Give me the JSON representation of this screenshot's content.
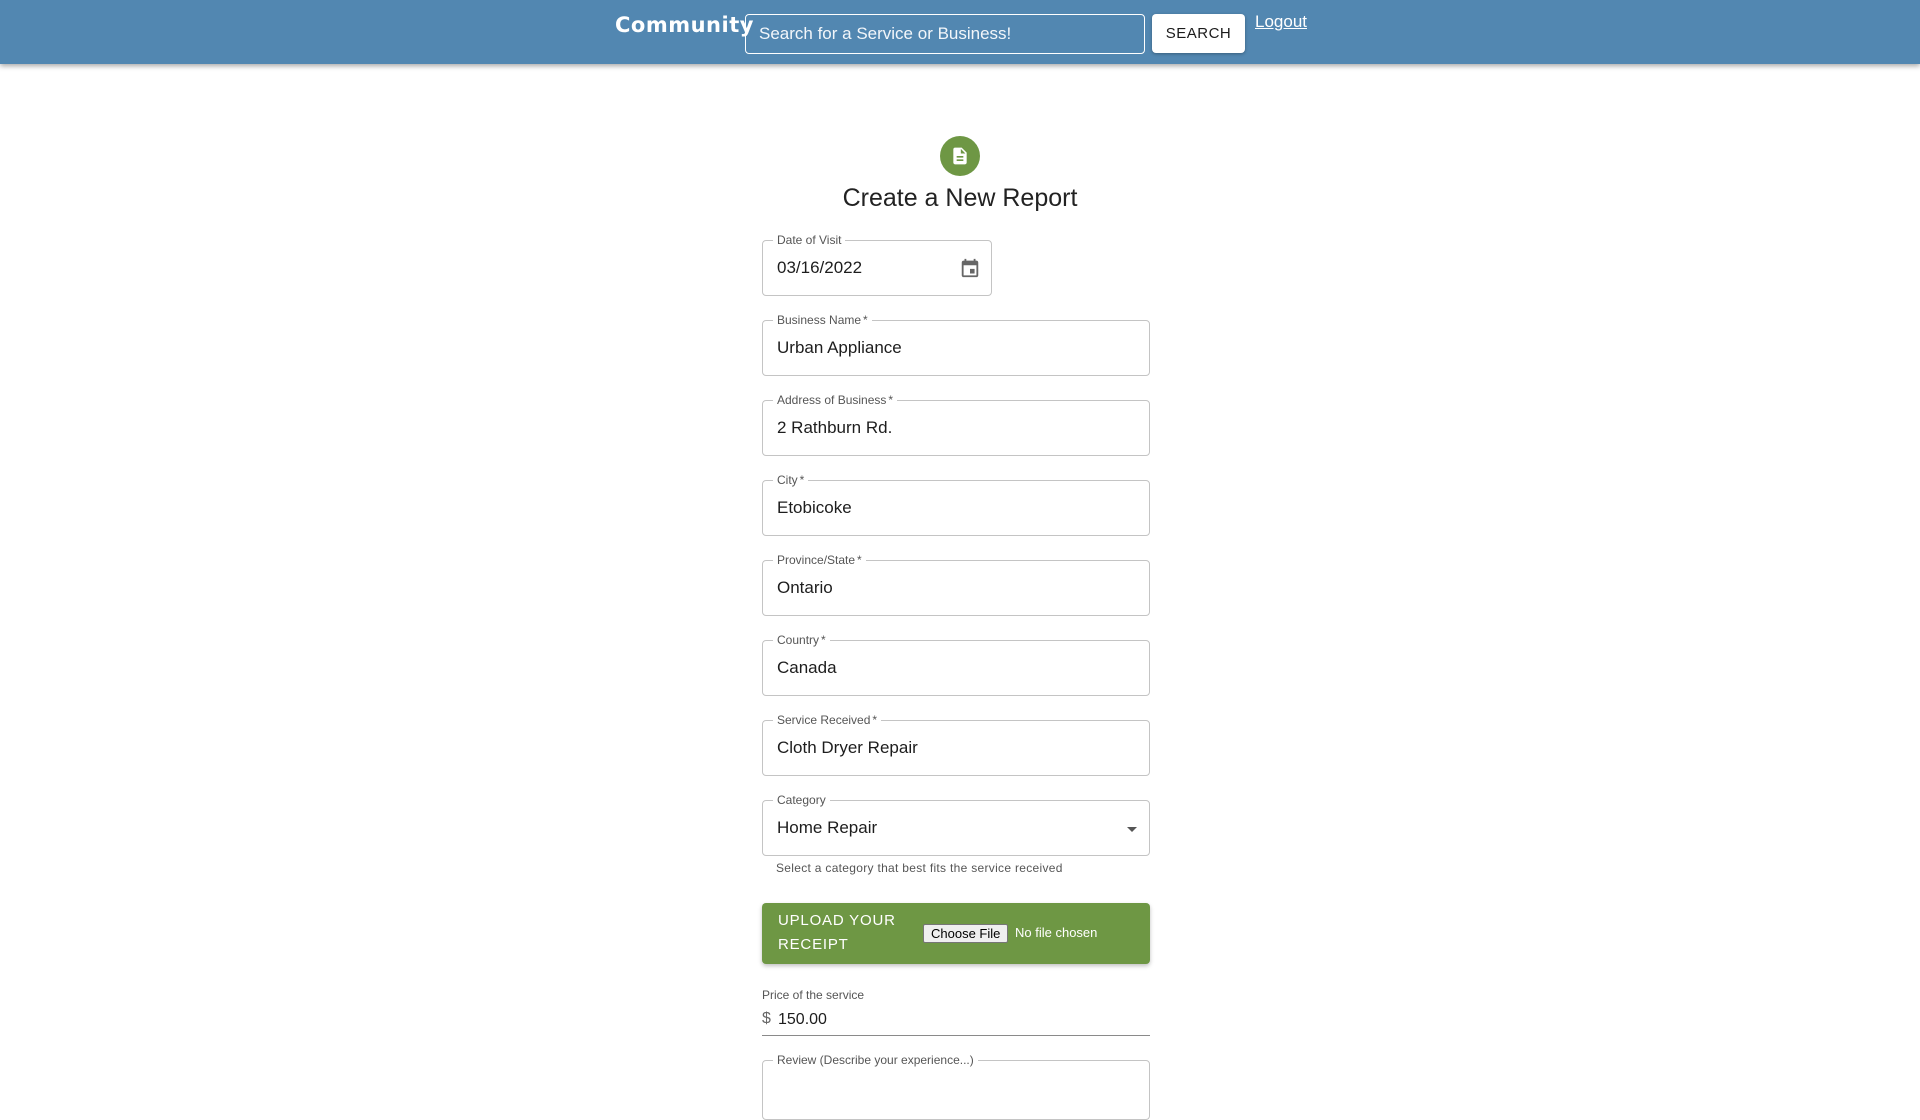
{
  "header": {
    "brand": "Community",
    "search_placeholder": "Search for a Service or Business!",
    "search_button": "SEARCH",
    "logout": "Logout",
    "bar_color": "#5287b1"
  },
  "form": {
    "title": "Create a New Report",
    "icon": "description-icon",
    "accent_color": "#6e9744",
    "fields": {
      "date": {
        "label": "Date of Visit",
        "value": "03/16/2022",
        "icon": "calendar-icon"
      },
      "business_name": {
        "label": "Business Name",
        "required_mark": "*",
        "value": "Urban Appliance"
      },
      "address": {
        "label": "Address of Business",
        "required_mark": "*",
        "value": "2 Rathburn Rd."
      },
      "city": {
        "label": "City",
        "required_mark": "*",
        "value": "Etobicoke"
      },
      "province": {
        "label": "Province/State",
        "required_mark": "*",
        "value": "Ontario"
      },
      "country": {
        "label": "Country",
        "required_mark": "*",
        "value": "Canada"
      },
      "service": {
        "label": "Service Received",
        "required_mark": "*",
        "value": "Cloth Dryer Repair"
      },
      "category": {
        "label": "Category",
        "value": "Home Repair",
        "helper": "Select a category that best fits the service received",
        "icon": "dropdown-arrow-icon"
      }
    },
    "upload": {
      "label": "Upload your receipt",
      "choose_button": "Choose File",
      "status": "No file chosen"
    },
    "price": {
      "label": "Price of the service",
      "prefix": "$",
      "value": "150.00"
    },
    "review": {
      "label": "Review (Describe your experience...)"
    }
  }
}
